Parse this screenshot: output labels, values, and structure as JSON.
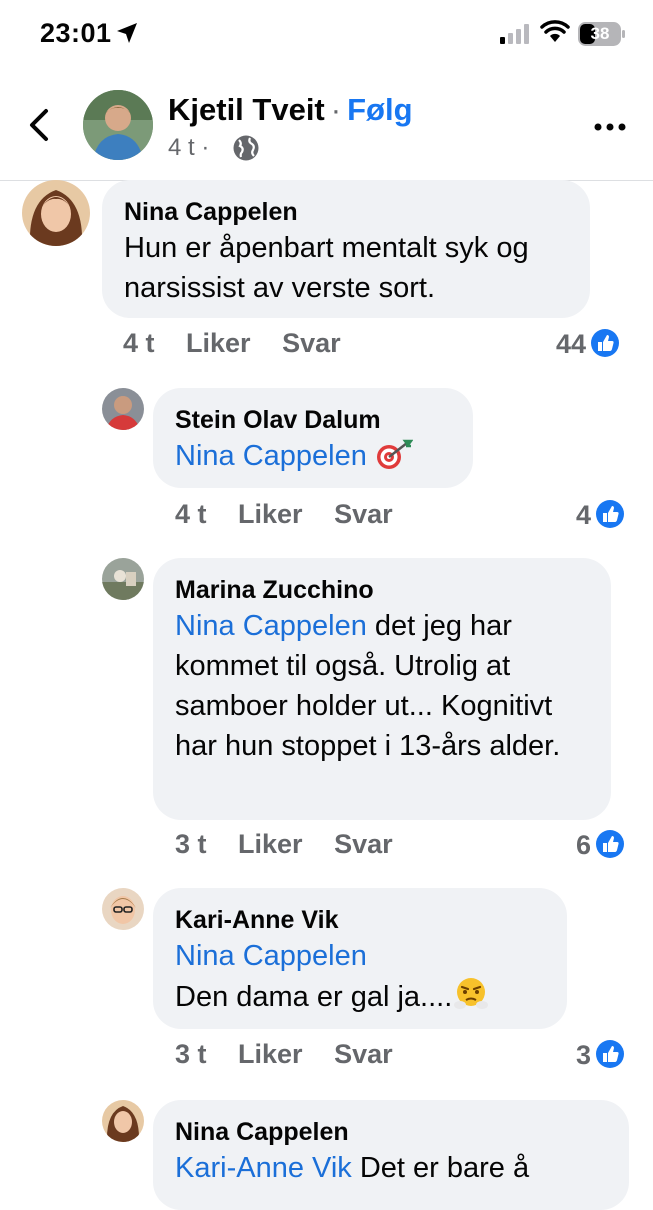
{
  "status_bar": {
    "time": "23:01",
    "battery": "38"
  },
  "header": {
    "name": "Kjetil Tveit",
    "separator": "·",
    "follow_label": "Følg",
    "meta": "4 t ·"
  },
  "comments": [
    {
      "author": "Nina Cappelen",
      "mention": "",
      "text": "Hun er åpenbart mentalt syk og narsissist av verste sort.",
      "time": "4 t",
      "like_label": "Liker",
      "reply_label": "Svar",
      "reactions": "44"
    },
    {
      "author": "Stein Olav Dalum",
      "mention": "Nina Cappelen",
      "text": "",
      "emoji": "dart-emoji",
      "time": "4 t",
      "like_label": "Liker",
      "reply_label": "Svar",
      "reactions": "4"
    },
    {
      "author": "Marina Zucchino",
      "mention": "Nina Cappelen",
      "text": " det jeg har kommet til også. Utrolig at samboer holder ut... Kognitivt har hun stoppet i 13-års alder.",
      "time": "3 t",
      "like_label": "Liker",
      "reply_label": "Svar",
      "reactions": "6"
    },
    {
      "author": "Kari-Anne Vik",
      "mention": "Nina Cappelen",
      "text": "Den dama er gal ja....",
      "emoji": "steam-face-emoji",
      "time": "3 t",
      "like_label": "Liker",
      "reply_label": "Svar",
      "reactions": "3"
    },
    {
      "author": "Nina Cappelen",
      "mention": "Kari-Anne Vik",
      "text": " Det er bare å",
      "time": "",
      "like_label": "",
      "reply_label": "",
      "reactions": ""
    }
  ],
  "colors": {
    "accent": "#1877f2",
    "bubble": "#f0f2f5",
    "meta": "#65676b"
  },
  "icons": [
    "location-arrow-icon",
    "signal-icon",
    "wifi-icon",
    "battery-icon",
    "back-chevron-icon",
    "globe-icon",
    "more-dots-icon",
    "like-thumb-icon"
  ]
}
